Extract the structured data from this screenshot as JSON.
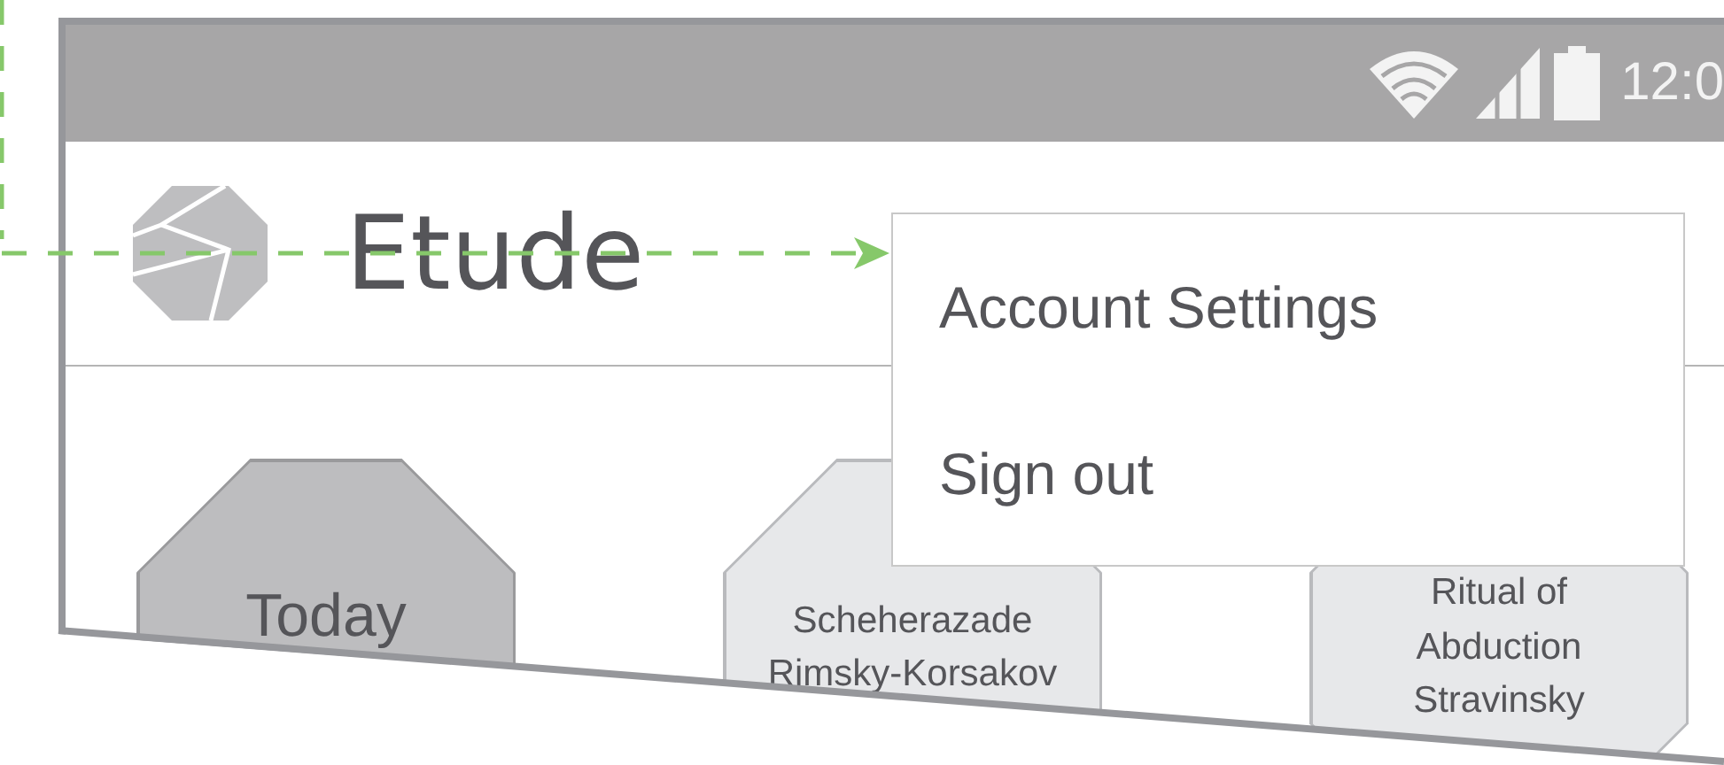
{
  "status_bar": {
    "time": "12:0"
  },
  "app_bar": {
    "title": "Etude"
  },
  "tiles": [
    {
      "lines": [
        "Today"
      ],
      "selected": true
    },
    {
      "lines": [
        "Scheherazade",
        "Rimsky-Korsakov"
      ],
      "selected": false
    },
    {
      "lines": [
        "Ritual of",
        "Abduction",
        "Stravinsky"
      ],
      "selected": false
    }
  ],
  "menu": {
    "items": [
      "Account Settings",
      "Sign out"
    ]
  }
}
